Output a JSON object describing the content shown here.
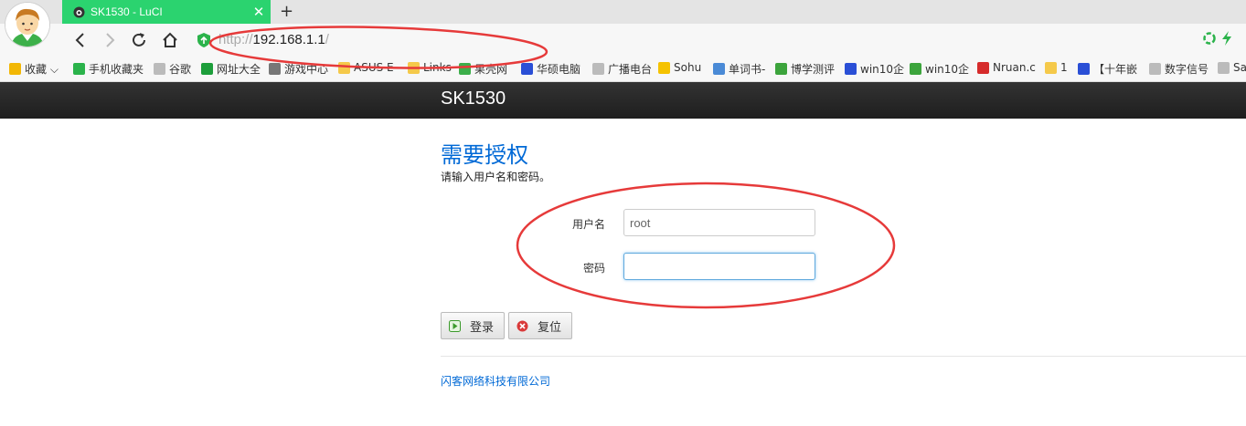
{
  "browser": {
    "tab_title": "SK1530 - LuCI",
    "new_tab_label": "+",
    "close_label": "✕",
    "url": {
      "scheme": "http://",
      "host": "192.168.1.1",
      "path": "/"
    }
  },
  "bookmarks": [
    {
      "label": "收藏 ⌵",
      "icon": "star-icon",
      "color": "#f2b705"
    },
    {
      "label": "手机收藏夹",
      "icon": "phone-icon",
      "color": "#2bb34b"
    },
    {
      "label": "谷歌",
      "icon": "page-icon",
      "color": "#bbbbbb"
    },
    {
      "label": "网址大全",
      "icon": "nav-icon",
      "color": "#1d9e3b"
    },
    {
      "label": "游戏中心",
      "icon": "gamepad-icon",
      "color": "#777777"
    },
    {
      "label": "ASUS E-",
      "icon": "folder-icon",
      "color": "#f5c94a"
    },
    {
      "label": "Links",
      "icon": "folder-icon",
      "color": "#f5c94a"
    },
    {
      "label": "果壳网",
      "icon": "guokr-icon",
      "color": "#3cae4a"
    },
    {
      "label": "华硕电脑",
      "icon": "paw-icon",
      "color": "#2a4fd6"
    },
    {
      "label": "广播电台",
      "icon": "page-icon",
      "color": "#bbbbbb"
    },
    {
      "label": "Sohu",
      "icon": "sohu-icon",
      "color": "#f5c200"
    },
    {
      "label": "单词书-",
      "icon": "book-icon",
      "color": "#4a8ad6"
    },
    {
      "label": "博学测评",
      "icon": "circle-icon",
      "color": "#3ca43c"
    },
    {
      "label": "win10企",
      "icon": "paw-icon",
      "color": "#2a4fd6"
    },
    {
      "label": "win10企",
      "icon": "leaf-icon",
      "color": "#3ca43c"
    },
    {
      "label": "Nruan.c",
      "icon": "n-icon",
      "color": "#d62b2b"
    },
    {
      "label": "1",
      "icon": "folder-icon",
      "color": "#f5c94a"
    },
    {
      "label": "【十年嵌",
      "icon": "paw-icon",
      "color": "#2a4fd6"
    },
    {
      "label": "数字信号",
      "icon": "page-icon",
      "color": "#bbbbbb"
    },
    {
      "label": "Sa",
      "icon": "page-icon",
      "color": "#bbbbbb"
    }
  ],
  "header": {
    "brand": "SK1530"
  },
  "login": {
    "title": "需要授权",
    "description": "请输入用户名和密码。",
    "username_label": "用户名",
    "username_value": "root",
    "password_label": "密码",
    "password_value": "",
    "login_button": "登录",
    "reset_button": "复位"
  },
  "footer": {
    "text": "闪客网络科技有限公司"
  },
  "colors": {
    "tab_green": "#2bd36f",
    "link_blue": "#0069d6",
    "annotation_red": "#e63a3a",
    "header_dark": "#222222"
  }
}
